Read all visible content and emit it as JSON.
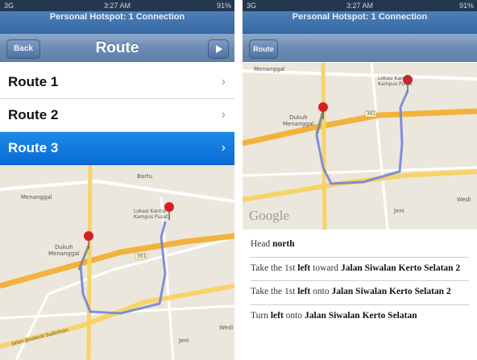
{
  "status_bar": {
    "signal": "3G",
    "time": "3:27 AM",
    "battery": "91%"
  },
  "hotspot_banner": "Personal Hotspot: 1 Connection",
  "left_screen": {
    "back_label": "Back",
    "title": "Route",
    "routes": [
      {
        "label": "Route 1",
        "selected": false
      },
      {
        "label": "Route 2",
        "selected": false
      },
      {
        "label": "Route 3",
        "selected": true
      }
    ],
    "map_labels": {
      "area_top": "Bartu",
      "area_left": "Menanggal",
      "dukuh": "Dukuh\nMenanggal",
      "destination": "Lokasi Kantor\nKampus Pusat",
      "road_badge": "361",
      "road_name": "Jalan Jenderal Sudirman",
      "lower_right": "Wedi",
      "lower": "Jeni"
    }
  },
  "right_screen": {
    "back_label": "Route",
    "map_labels": {
      "area_top": "Menanggal",
      "dukuh": "Dukuh\nMenanggal",
      "destination": "Lokasi Kantor\nKampus Pusat",
      "road_badge": "361",
      "lower_right": "Wedi",
      "lower": "Jeni",
      "google": "Google"
    },
    "directions": [
      {
        "pre": "Head ",
        "bold": "north",
        "mid": "",
        "bold2": ""
      },
      {
        "pre": "Take the 1st ",
        "bold": "left",
        "mid": " toward ",
        "bold2": "Jalan Siwalan Kerto Selatan 2"
      },
      {
        "pre": "Take the 1st ",
        "bold": "left",
        "mid": " onto ",
        "bold2": "Jalan Siwalan Kerto Selatan 2"
      },
      {
        "pre": "Turn ",
        "bold": "left",
        "mid": " onto ",
        "bold2": "Jalan Siwalan Kerto Selatan"
      }
    ]
  },
  "colors": {
    "nav_blue": "#5f7fa9",
    "selected_row": "#0a6bd6",
    "route_line": "#6c7fd6",
    "highway": "#f2b23c",
    "pin": "#d62027"
  }
}
